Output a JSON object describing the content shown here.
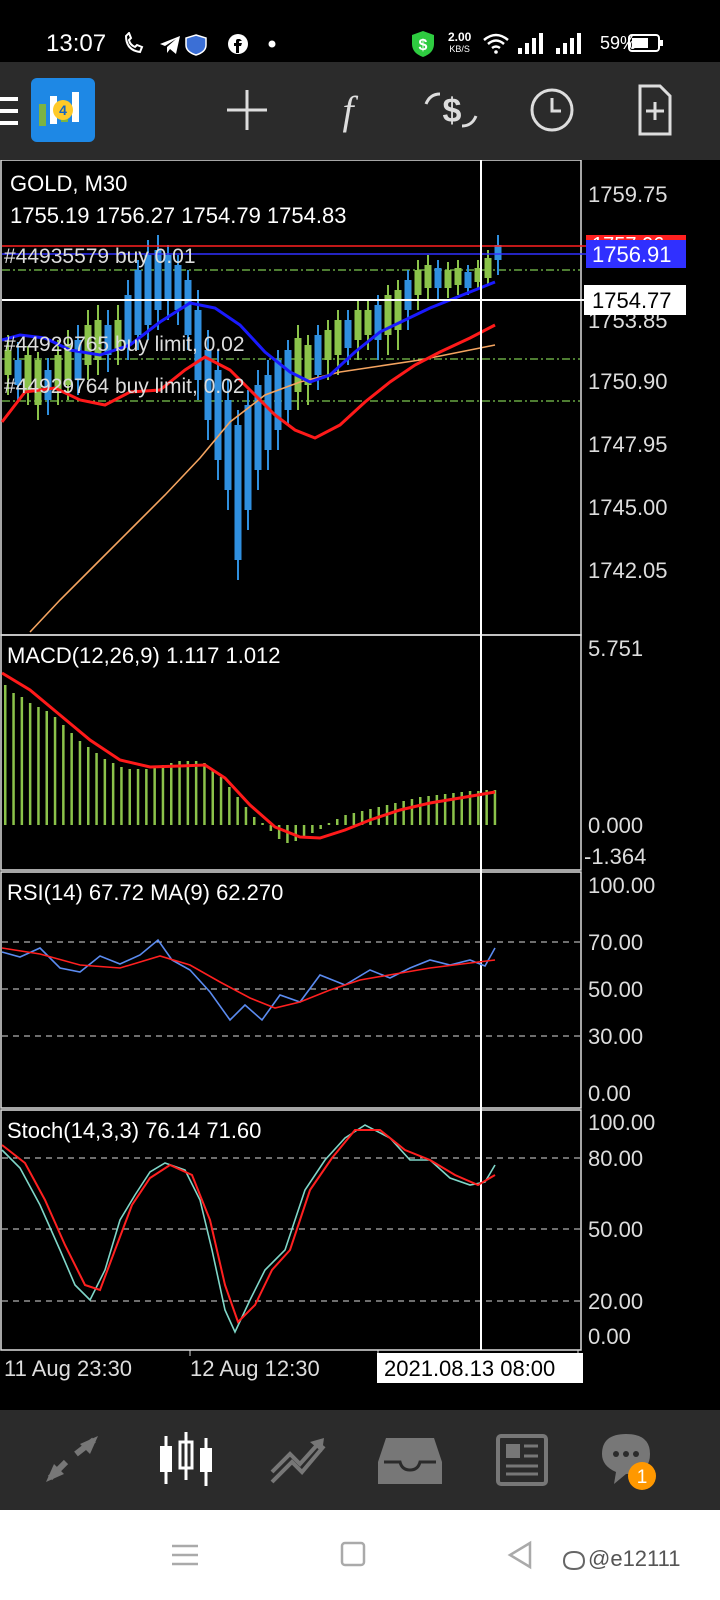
{
  "status_bar": {
    "time": "13:07",
    "net_speed_value": "2.00",
    "net_speed_unit": "KB/S",
    "battery": "59%"
  },
  "toolbar": {
    "icons": [
      "app-logo-icon",
      "crosshair-icon",
      "function-icon",
      "symbols-icon",
      "period-clock-icon",
      "new-order-icon"
    ]
  },
  "chart": {
    "symbol_period": "GOLD, M30",
    "ohlc": "1755.19 1756.27 1754.79 1754.83",
    "ask_price": "1757.06",
    "bid_price": "1756.91",
    "crosshair_price": "1754.77",
    "crosshair_time": "2021.08.13 08:00",
    "orders": [
      {
        "label": "#44935579 buy 0.01",
        "price": 1756.2
      },
      {
        "label": "#44929765 buy limit, 0.02",
        "price": 1752.1
      },
      {
        "label": "#44929764 buy limit, 0.02",
        "price": 1749.2
      }
    ],
    "colors": {
      "bull": "#8bc34a",
      "bear": "#2f8fdf",
      "ma_fast": "#1a1aff",
      "ma_mid": "#ff1a1a",
      "ma_slow": "#f4a460",
      "ask": "#ff2020",
      "bid": "#3030ff",
      "level": "#7ec850"
    },
    "price_axis": [
      "1759.75",
      "1753.85",
      "1750.90",
      "1747.95",
      "1745.00",
      "1742.05"
    ],
    "time_axis": [
      "11 Aug 23:30",
      "12 Aug 12:30"
    ],
    "macd": {
      "label": "MACD(12,26,9) 1.117 1.012",
      "axis": [
        "5.751",
        "0.000",
        "-1.364"
      ]
    },
    "rsi": {
      "label": "RSI(14) 67.72 MA(9) 62.270",
      "axis": [
        "100.00",
        "70.00",
        "50.00",
        "30.00",
        "0.00"
      ]
    },
    "stoch": {
      "label": "Stoch(14,3,3) 76.14 71.60",
      "axis": [
        "100.00",
        "80.00",
        "50.00",
        "20.00",
        "0.00"
      ]
    }
  },
  "bottom_nav": {
    "icons": [
      "quotes-icon",
      "chart-icon",
      "trade-icon",
      "history-icon",
      "news-icon",
      "messages-icon"
    ],
    "badge": "1"
  },
  "watermark": "@e12111"
}
